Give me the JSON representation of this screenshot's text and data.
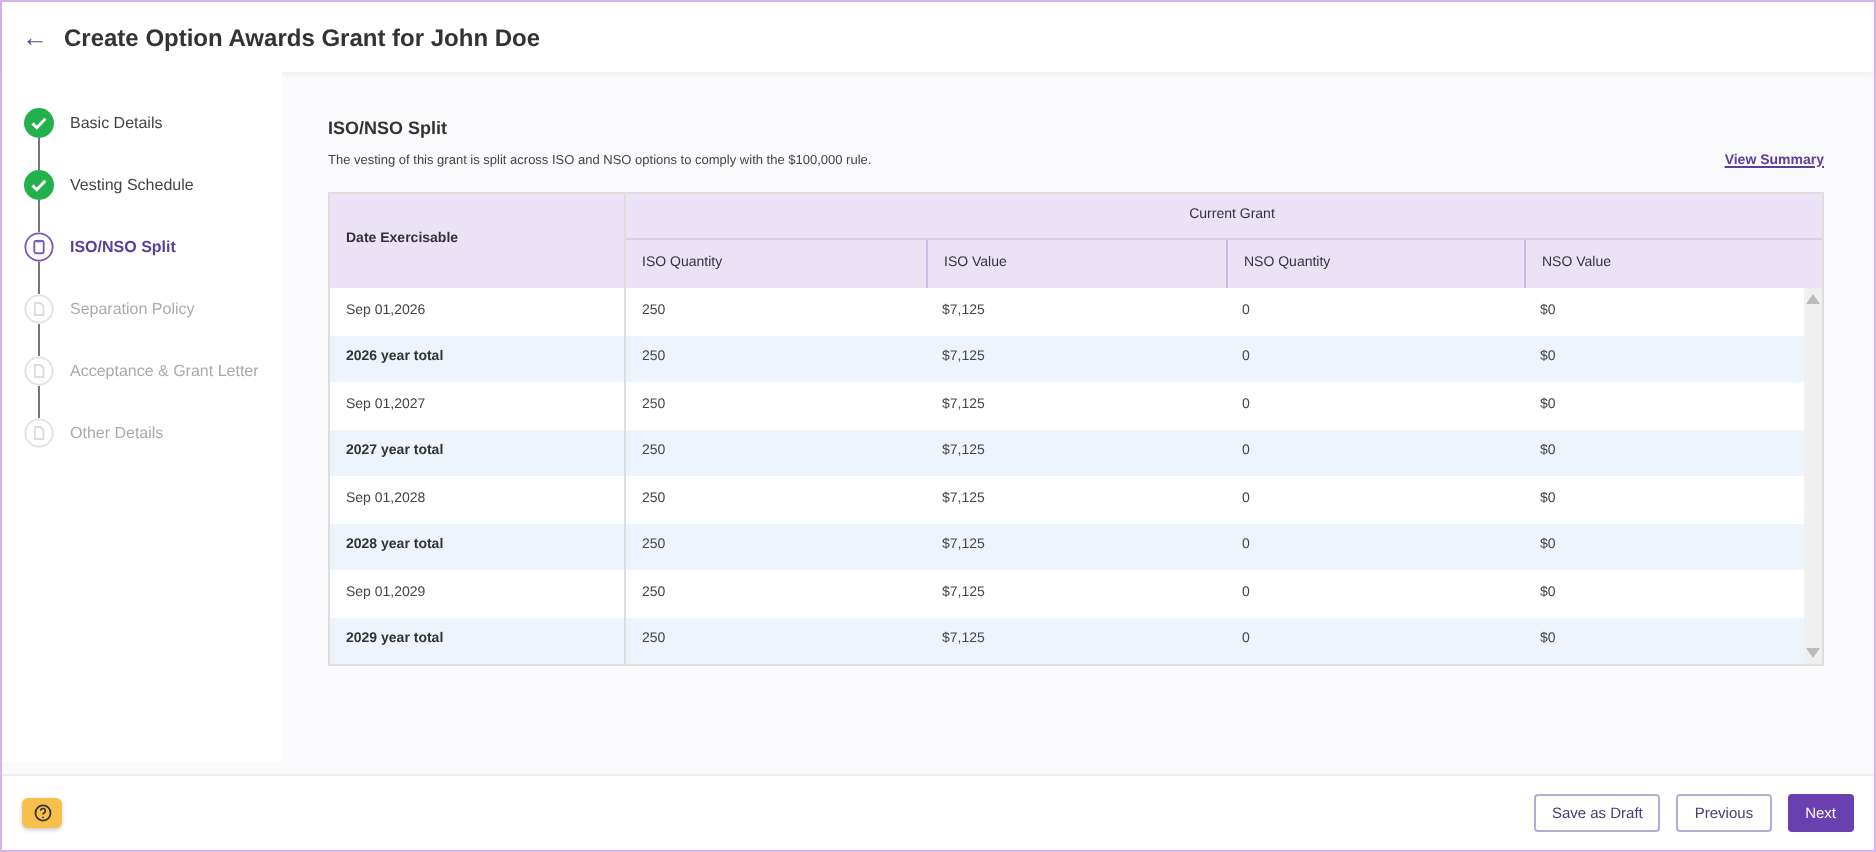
{
  "header": {
    "back": "←",
    "title": "Create Option Awards Grant for John Doe"
  },
  "steps": [
    {
      "label": "Basic Details",
      "completed": true,
      "selected": false
    },
    {
      "label": "Vesting Schedule",
      "completed": true,
      "selected": false
    },
    {
      "label": "ISO/NSO Split",
      "completed": false,
      "selected": true
    },
    {
      "label": "Separation Policy",
      "completed": false,
      "selected": false
    },
    {
      "label": "Acceptance & Grant Letter",
      "completed": false,
      "selected": false
    },
    {
      "label": "Other Details",
      "completed": false,
      "selected": false
    }
  ],
  "section": {
    "title": "ISO/NSO Split",
    "description": "The vesting of this grant is split across ISO and NSO options to comply with the $100,000 rule.",
    "link": "View Summary"
  },
  "table": {
    "group": "Current Grant",
    "columns": [
      "Date Exercisable",
      "ISO Quantity",
      "ISO Value",
      "NSO Quantity",
      "NSO Value"
    ],
    "rows": [
      {
        "kind": "date",
        "cells": [
          "Sep 01,2026",
          "250",
          "$7,125",
          "0",
          "$0"
        ]
      },
      {
        "kind": "total",
        "cells": [
          "2026 year total",
          "250",
          "$7,125",
          "0",
          "$0"
        ]
      },
      {
        "kind": "date",
        "cells": [
          "Sep 01,2027",
          "250",
          "$7,125",
          "0",
          "$0"
        ]
      },
      {
        "kind": "total",
        "cells": [
          "2027 year total",
          "250",
          "$7,125",
          "0",
          "$0"
        ]
      },
      {
        "kind": "date",
        "cells": [
          "Sep 01,2028",
          "250",
          "$7,125",
          "0",
          "$0"
        ]
      },
      {
        "kind": "total",
        "cells": [
          "2028 year total",
          "250",
          "$7,125",
          "0",
          "$0"
        ]
      },
      {
        "kind": "date",
        "cells": [
          "Sep 01,2029",
          "250",
          "$7,125",
          "0",
          "$0"
        ]
      },
      {
        "kind": "total",
        "cells": [
          "2029 year total",
          "250",
          "$7,125",
          "0",
          "$0"
        ]
      }
    ]
  },
  "footer": {
    "buttons": [
      {
        "label": "Save as Draft",
        "kind": "outline"
      },
      {
        "label": "Previous",
        "kind": "outline"
      },
      {
        "label": "Next",
        "kind": "primary"
      }
    ]
  }
}
